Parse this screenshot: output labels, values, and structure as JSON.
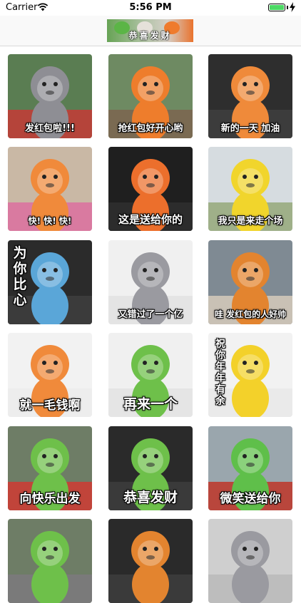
{
  "status_bar": {
    "carrier": "Carrier",
    "time": "5:56 PM"
  },
  "nav": {
    "banner_text": "恭喜发财"
  },
  "colors": {
    "accent_green": "#4cd964",
    "divider": "#dadada"
  },
  "stickers": [
    {
      "caption": "发红包啦!!!",
      "mascot": "grey-mouse",
      "bg": "#5a7d52",
      "ground": "#b5443a",
      "body": "#8e8e94",
      "vertical": false
    },
    {
      "caption": "抢红包好开心哟",
      "mascot": "lion-and-duck",
      "bg": "#6e8a62",
      "ground": "#7a6a52",
      "body": "#ee7d2c",
      "vertical": false
    },
    {
      "caption": "新的一天 加油",
      "mascot": "lion",
      "bg": "#2e2e2e",
      "ground": "#3c3c3c",
      "body": "#ef8a3a",
      "vertical": false
    },
    {
      "caption": "快! 快! 快!",
      "mascot": "lion-running",
      "bg": "#c9b8a5",
      "ground": "#d97aa0",
      "body": "#f08a3b",
      "vertical": false
    },
    {
      "caption": "这是送给你的",
      "mascot": "lion-gold",
      "bg": "#1f1f1f",
      "ground": "#2c2c2c",
      "body": "#ec6f2c",
      "vertical": false
    },
    {
      "caption": "我只是来走个场",
      "mascot": "frog-and-duck",
      "bg": "#d6dce0",
      "ground": "#9fb089",
      "body": "#f1d52c",
      "vertical": false
    },
    {
      "caption": "为你比心",
      "mascot": "blue-monkey",
      "bg": "#2b2b2b",
      "ground": "#3b3b3b",
      "body": "#5aa6d8",
      "vertical": true
    },
    {
      "caption": "又错过了一个亿",
      "mascot": "grey-mouse",
      "bg": "#f0f0f0",
      "ground": "#e4e4e4",
      "body": "#9a9aa0",
      "vertical": false
    },
    {
      "caption": "哇 发红包的人好帅",
      "mascot": "frog-lion-duck",
      "bg": "#7f8a93",
      "ground": "#c9c1b5",
      "body": "#e3842f",
      "vertical": false
    },
    {
      "caption": "就一毛钱啊",
      "mascot": "lion",
      "bg": "#f2f2f2",
      "ground": "#ededed",
      "body": "#f08a3b",
      "vertical": false
    },
    {
      "caption": "再来一个",
      "mascot": "frog",
      "bg": "#f0f0f0",
      "ground": "#e5e5e5",
      "body": "#6ec04a",
      "vertical": false
    },
    {
      "caption": "祝你年年有余",
      "mascot": "duck",
      "bg": "#f2f2f2",
      "ground": "#eaeaea",
      "body": "#f3d12a",
      "vertical": true
    },
    {
      "caption": "向快乐出发",
      "mascot": "lion-frog-mouse",
      "bg": "#6e7d66",
      "ground": "#c1443a",
      "body": "#6ec04a",
      "vertical": false
    },
    {
      "caption": "恭喜发财",
      "mascot": "frog-lion",
      "bg": "#2a2a2a",
      "ground": "#3a3a3a",
      "body": "#6ec04a",
      "vertical": false
    },
    {
      "caption": "微笑送给你",
      "mascot": "frog",
      "bg": "#9aa6ad",
      "ground": "#b9463c",
      "body": "#5fbf4a",
      "vertical": false
    },
    {
      "caption": "",
      "mascot": "frog",
      "bg": "#6e7d66",
      "ground": "#7a7a7a",
      "body": "#6ec04a",
      "vertical": false
    },
    {
      "caption": "",
      "mascot": "lion",
      "bg": "#2a2a2a",
      "ground": "#3a3a3a",
      "body": "#e3842f",
      "vertical": false
    },
    {
      "caption": "",
      "mascot": "grey-mouse",
      "bg": "#cfcfcf",
      "ground": "#bdbdbd",
      "body": "#9a9aa0",
      "vertical": false
    }
  ]
}
